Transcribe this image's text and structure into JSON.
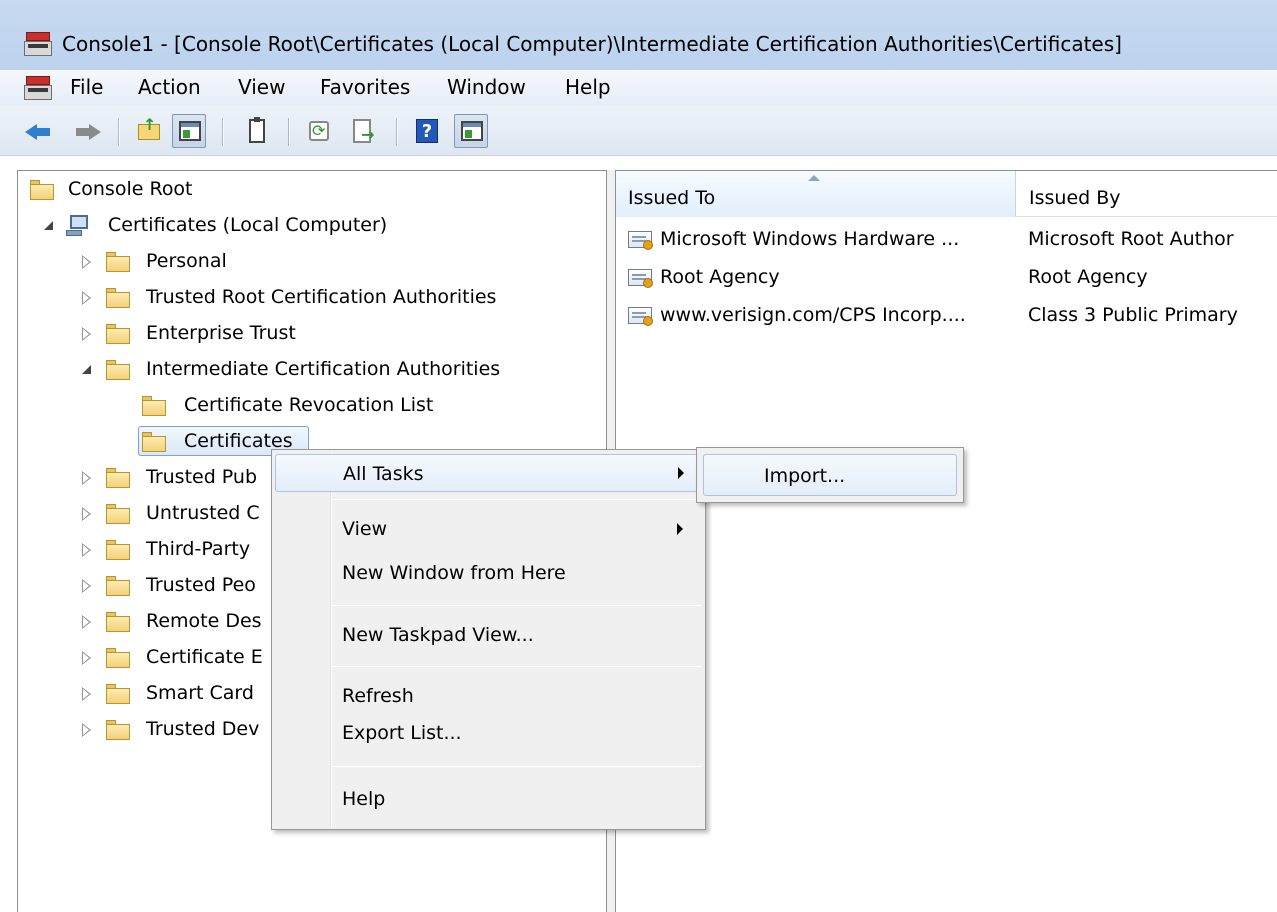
{
  "window": {
    "title": "Console1 - [Console Root\\Certificates (Local Computer)\\Intermediate Certification Authorities\\Certificates]"
  },
  "menubar": {
    "items": [
      "File",
      "Action",
      "View",
      "Favorites",
      "Window",
      "Help"
    ]
  },
  "toolbar": {
    "icons": [
      "back-arrow-icon",
      "forward-arrow-icon",
      "up-folder-icon",
      "show-hide-console-tree-icon",
      "properties-icon",
      "refresh-icon",
      "export-list-icon",
      "help-icon",
      "show-hide-action-pane-icon"
    ]
  },
  "tree": {
    "root": "Console Root",
    "computer": "Certificates (Local Computer)",
    "stores": [
      "Personal",
      "Trusted Root Certification Authorities",
      "Enterprise Trust",
      "Intermediate Certification Authorities",
      "Trusted Pub",
      "Untrusted C",
      "Third-Party",
      "Trusted Peo",
      "Remote Des",
      "Certificate E",
      "Smart Card",
      "Trusted Dev"
    ],
    "intermediate_children": [
      "Certificate Revocation List",
      "Certificates"
    ]
  },
  "list": {
    "columns": [
      "Issued To",
      "Issued By"
    ],
    "rows": [
      {
        "issued_to": "Microsoft Windows Hardware ...",
        "issued_by": "Microsoft Root Author"
      },
      {
        "issued_to": "Root Agency",
        "issued_by": "Root Agency"
      },
      {
        "issued_to": "www.verisign.com/CPS Incorp....",
        "issued_by": "Class 3 Public Primary"
      }
    ]
  },
  "context_menu": {
    "items": [
      "All Tasks",
      "View",
      "New Window from Here",
      "New Taskpad View...",
      "Refresh",
      "Export List...",
      "Help"
    ]
  },
  "submenu": {
    "items": [
      "Import..."
    ]
  },
  "colors": {
    "titlebar": "#c7daf0",
    "selection_border": "#7da2ce",
    "menu_background": "#f0f0f0"
  }
}
